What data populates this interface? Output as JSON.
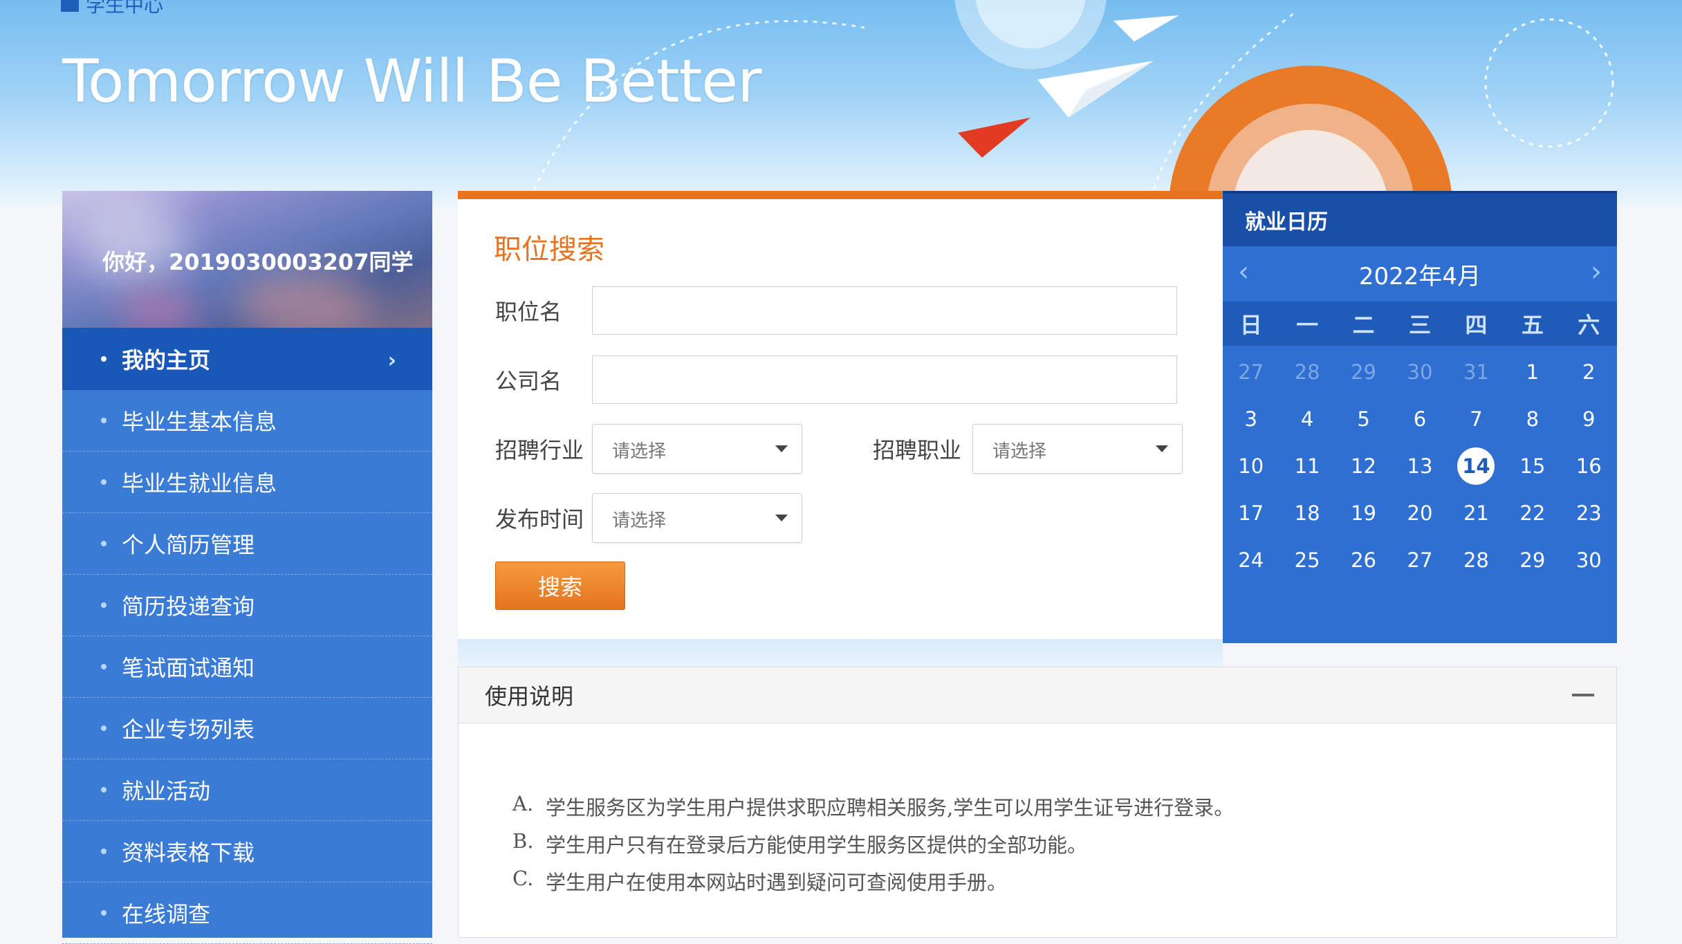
{
  "header": {
    "top_label": "学生中心",
    "slogan": "Tomorrow Will Be Better"
  },
  "sidebar": {
    "greeting": "你好，2019030003207同学",
    "items": [
      {
        "label": "我的主页",
        "active": true
      },
      {
        "label": "毕业生基本信息"
      },
      {
        "label": "毕业生就业信息"
      },
      {
        "label": "个人简历管理"
      },
      {
        "label": "简历投递查询"
      },
      {
        "label": "笔试面试通知"
      },
      {
        "label": "企业专场列表"
      },
      {
        "label": "就业活动"
      },
      {
        "label": "资料表格下载"
      },
      {
        "label": "在线调查"
      }
    ]
  },
  "search": {
    "title": "职位搜索",
    "job_name_label": "职位名",
    "job_name_value": "",
    "company_label": "公司名",
    "company_value": "",
    "industry_label": "招聘行业",
    "industry_value": "请选择",
    "occupation_label": "招聘职业",
    "occupation_value": "请选择",
    "time_label": "发布时间",
    "time_value": "请选择",
    "button_label": "搜索"
  },
  "calendar": {
    "title": "就业日历",
    "month": "2022年4月",
    "prev": "‹",
    "next": "›",
    "weekdays": [
      "日",
      "一",
      "二",
      "三",
      "四",
      "五",
      "六"
    ],
    "days": [
      {
        "d": "27",
        "other": true
      },
      {
        "d": "28",
        "other": true
      },
      {
        "d": "29",
        "other": true
      },
      {
        "d": "30",
        "other": true
      },
      {
        "d": "31",
        "other": true
      },
      {
        "d": "1"
      },
      {
        "d": "2"
      },
      {
        "d": "3"
      },
      {
        "d": "4"
      },
      {
        "d": "5"
      },
      {
        "d": "6"
      },
      {
        "d": "7"
      },
      {
        "d": "8"
      },
      {
        "d": "9"
      },
      {
        "d": "10"
      },
      {
        "d": "11"
      },
      {
        "d": "12"
      },
      {
        "d": "13"
      },
      {
        "d": "14",
        "today": true
      },
      {
        "d": "15"
      },
      {
        "d": "16"
      },
      {
        "d": "17"
      },
      {
        "d": "18"
      },
      {
        "d": "19"
      },
      {
        "d": "20"
      },
      {
        "d": "21"
      },
      {
        "d": "22"
      },
      {
        "d": "23"
      },
      {
        "d": "24"
      },
      {
        "d": "25"
      },
      {
        "d": "26"
      },
      {
        "d": "27"
      },
      {
        "d": "28"
      },
      {
        "d": "29"
      },
      {
        "d": "30"
      }
    ]
  },
  "instructions": {
    "title": "使用说明",
    "collapse_icon": "minus-icon",
    "items": [
      {
        "marker": "A.",
        "text": "学生服务区为学生用户提供求职应聘相关服务,学生可以用学生证号进行登录。"
      },
      {
        "marker": "B.",
        "text": "学生用户只有在登录后方能使用学生服务区提供的全部功能。"
      },
      {
        "marker": "C.",
        "text": "学生用户在使用本网站时遇到疑问可查阅使用手册。"
      }
    ]
  },
  "colors": {
    "accent_orange": "#e8731e",
    "sidebar_blue": "#3a7bd5",
    "sidebar_active": "#1a58b8",
    "calendar_blue": "#2e6fd1"
  }
}
